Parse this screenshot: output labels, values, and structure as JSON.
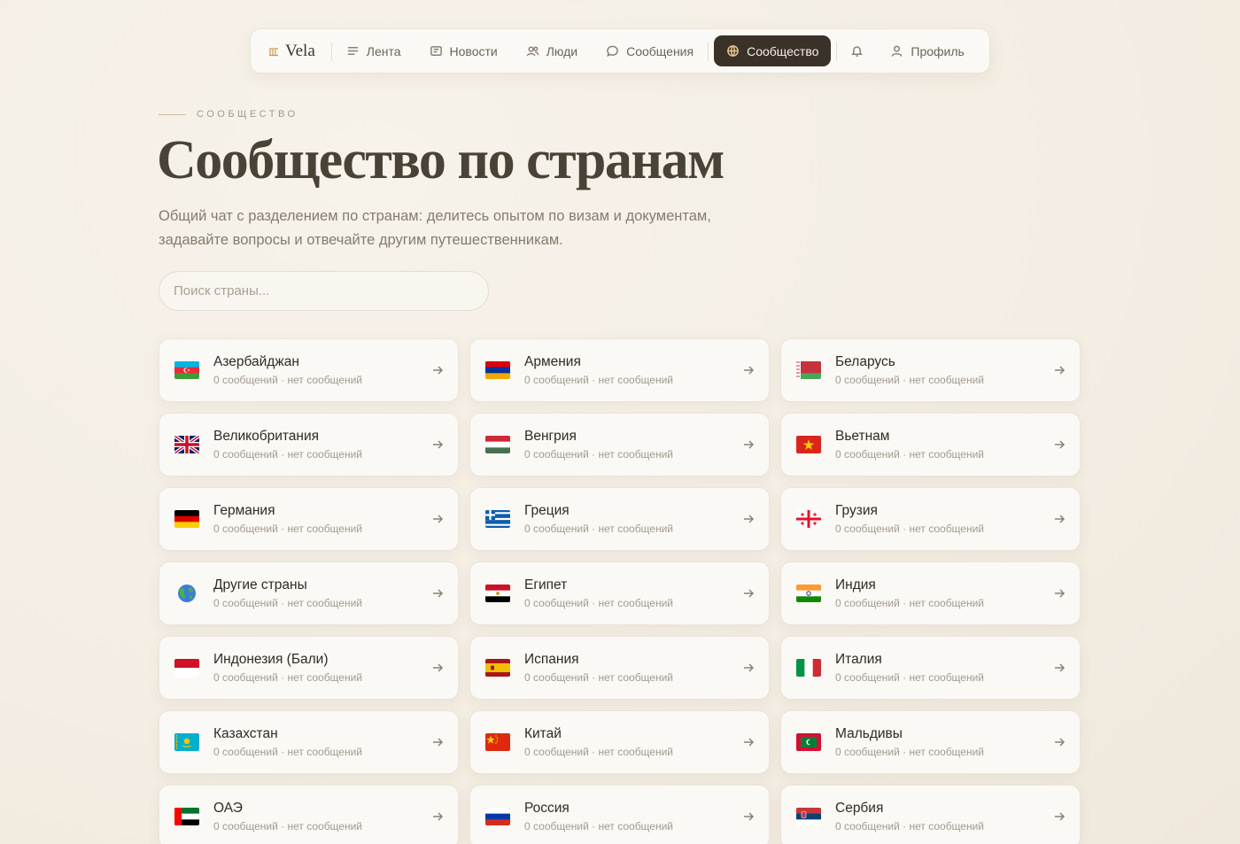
{
  "nav": {
    "brand": "Vela",
    "items": [
      {
        "label": "Лента",
        "icon": "feed-icon"
      },
      {
        "label": "Новости",
        "icon": "news-icon"
      },
      {
        "label": "Люди",
        "icon": "people-icon"
      },
      {
        "label": "Сообщения",
        "icon": "chat-icon"
      },
      {
        "label": "Сообщество",
        "icon": "globe-icon",
        "active": true
      }
    ],
    "profile_label": "Профиль"
  },
  "header": {
    "eyebrow": "СООБЩЕСТВО",
    "title": "Сообщество по странам",
    "description": "Общий чат с разделением по странам: делитесь опытом по визам и документам, задавайте вопросы и отвечайте другим путешественникам."
  },
  "search": {
    "placeholder": "Поиск страны..."
  },
  "countries": [
    {
      "name": "Азербайджан",
      "meta": "0 сообщений · нет сообщений",
      "flag": "az"
    },
    {
      "name": "Армения",
      "meta": "0 сообщений · нет сообщений",
      "flag": "am"
    },
    {
      "name": "Беларусь",
      "meta": "0 сообщений · нет сообщений",
      "flag": "by"
    },
    {
      "name": "Великобритания",
      "meta": "0 сообщений · нет сообщений",
      "flag": "gb"
    },
    {
      "name": "Венгрия",
      "meta": "0 сообщений · нет сообщений",
      "flag": "hu"
    },
    {
      "name": "Вьетнам",
      "meta": "0 сообщений · нет сообщений",
      "flag": "vn"
    },
    {
      "name": "Германия",
      "meta": "0 сообщений · нет сообщений",
      "flag": "de"
    },
    {
      "name": "Греция",
      "meta": "0 сообщений · нет сообщений",
      "flag": "gr"
    },
    {
      "name": "Грузия",
      "meta": "0 сообщений · нет сообщений",
      "flag": "ge"
    },
    {
      "name": "Другие страны",
      "meta": "0 сообщений · нет сообщений",
      "flag": "globe"
    },
    {
      "name": "Египет",
      "meta": "0 сообщений · нет сообщений",
      "flag": "eg"
    },
    {
      "name": "Индия",
      "meta": "0 сообщений · нет сообщений",
      "flag": "in"
    },
    {
      "name": "Индонезия (Бали)",
      "meta": "0 сообщений · нет сообщений",
      "flag": "id"
    },
    {
      "name": "Испания",
      "meta": "0 сообщений · нет сообщений",
      "flag": "es"
    },
    {
      "name": "Италия",
      "meta": "0 сообщений · нет сообщений",
      "flag": "it"
    },
    {
      "name": "Казахстан",
      "meta": "0 сообщений · нет сообщений",
      "flag": "kz"
    },
    {
      "name": "Китай",
      "meta": "0 сообщений · нет сообщений",
      "flag": "cn"
    },
    {
      "name": "Мальдивы",
      "meta": "0 сообщений · нет сообщений",
      "flag": "mv"
    },
    {
      "name": "ОАЭ",
      "meta": "0 сообщений · нет сообщений",
      "flag": "ae"
    },
    {
      "name": "Россия",
      "meta": "0 сообщений · нет сообщений",
      "flag": "ru"
    },
    {
      "name": "Сербия",
      "meta": "0 сообщений · нет сообщений",
      "flag": "rs"
    }
  ],
  "colors": {
    "accent_dark": "#3a3228",
    "accent_gold": "#e3c68f",
    "background": "#f3ede3"
  }
}
